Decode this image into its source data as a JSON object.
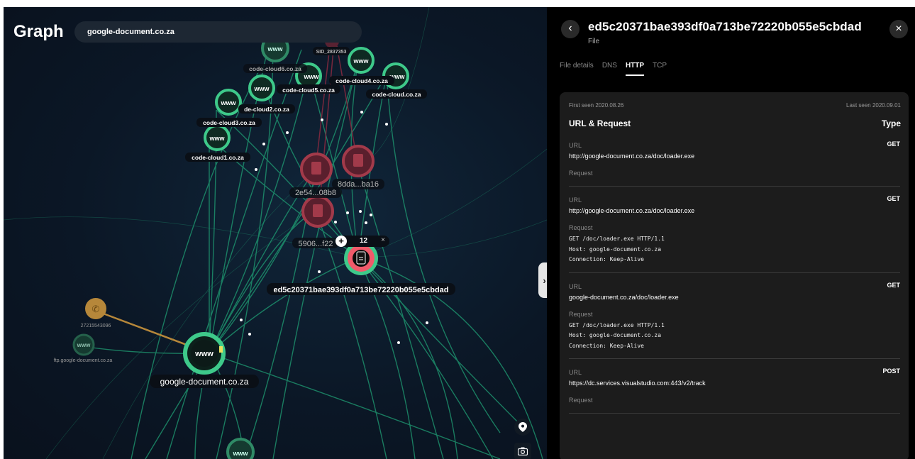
{
  "graph": {
    "title": "Graph",
    "search_value": "google-document.co.za",
    "labels": {
      "sid": "SID_2837353",
      "code_cloud6": "code-cloud6.co.za",
      "code_cloud5": "code-cloud5.co.za",
      "code_cloud4": "code-cloud4.co.za",
      "code_cloud": "code-cloud.co.za",
      "code_cloud2": "de-cloud2.co.za",
      "code_cloud3": "code-cloud3.co.za",
      "code_cloud1": "code-cloud1.co.za",
      "file_2e54": "2e54...08b8",
      "file_8dda": "8dda...ba16",
      "file_5906": "5906...f22",
      "selected_file": "ed5c20371bae393df0a713be72220b055e5cbdad",
      "phone": "27215543096",
      "ftp": "ftp.google-document.co.za",
      "main_domain": "google-document.co.za"
    },
    "www_text": "www",
    "popup": {
      "plus": "+",
      "count": "12",
      "close": "×"
    },
    "collapse_icon": "›",
    "map_tools": {
      "pin": "⬤",
      "camera": "◙"
    }
  },
  "detail": {
    "back_icon": "‹",
    "close_icon": "×",
    "title": "ed5c20371bae393df0a713be72220b055e5cbdad",
    "subtitle": "File",
    "tabs": [
      "File details",
      "DNS",
      "HTTP",
      "TCP"
    ],
    "active_tab": "HTTP",
    "first_seen": "First seen 2020.08.26",
    "last_seen": "Last seen 2020.09.01",
    "section_title": "URL & Request",
    "type_header": "Type",
    "url_label": "URL",
    "request_label": "Request",
    "requests": [
      {
        "type": "GET",
        "url": "http://google-document.co.za/doc/loader.exe",
        "body": ""
      },
      {
        "type": "GET",
        "url": "http://google-document.co.za/doc/loader.exe",
        "body": "GET /doc/loader.exe HTTP/1.1\nHost: google-document.co.za\nConnection: Keep-Alive"
      },
      {
        "type": "GET",
        "url": "google-document.co.za/doc/loader.exe",
        "body": "GET /doc/loader.exe HTTP/1.1\nHost: google-document.co.za\nConnection: Keep-Alive"
      },
      {
        "type": "POST",
        "url": "https://dc.services.visualstudio.com:443/v2/track",
        "body": ""
      }
    ]
  },
  "colors": {
    "edge": "#1f9e74",
    "domain_node": "#3ec98a",
    "file_node": "#a23a4a",
    "selected_file_ring": "#f05a6a",
    "phone_node": "#b6873a"
  }
}
